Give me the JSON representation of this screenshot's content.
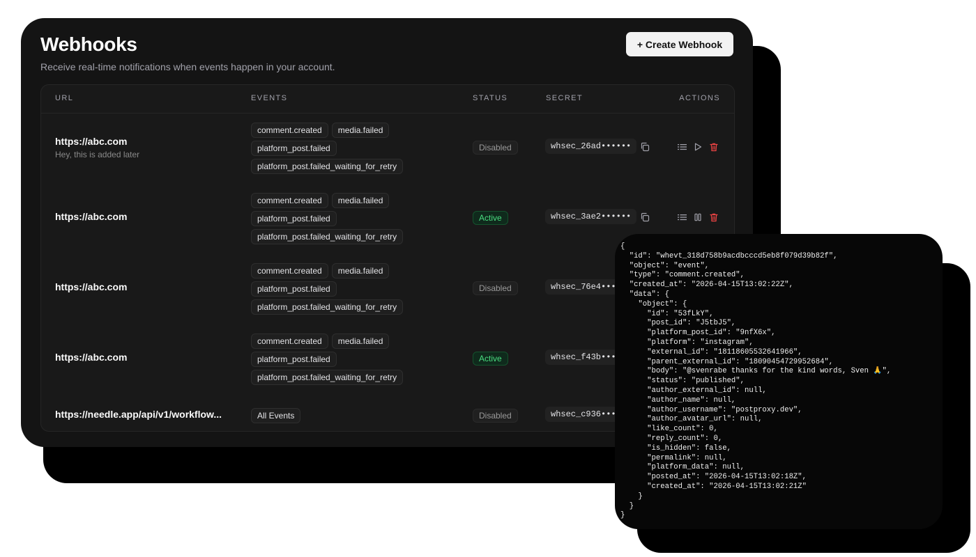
{
  "header": {
    "title": "Webhooks",
    "subtitle": "Receive real-time notifications when events happen in your account.",
    "create_button": "+ Create Webhook"
  },
  "table": {
    "columns": [
      "URL",
      "EVENTS",
      "STATUS",
      "SECRET",
      "ACTIONS"
    ],
    "rows": [
      {
        "url": "https://abc.com",
        "description": "Hey, this is added later",
        "events": [
          "comment.created",
          "media.failed",
          "platform_post.failed",
          "platform_post.failed_waiting_for_retry"
        ],
        "status": "Disabled",
        "secret": "whsec_26ad••••••"
      },
      {
        "url": "https://abc.com",
        "description": "",
        "events": [
          "comment.created",
          "media.failed",
          "platform_post.failed",
          "platform_post.failed_waiting_for_retry"
        ],
        "status": "Active",
        "secret": "whsec_3ae2••••••"
      },
      {
        "url": "https://abc.com",
        "description": "",
        "events": [
          "comment.created",
          "media.failed",
          "platform_post.failed",
          "platform_post.failed_waiting_for_retry"
        ],
        "status": "Disabled",
        "secret": "whsec_76e4••••••"
      },
      {
        "url": "https://abc.com",
        "description": "",
        "events": [
          "comment.created",
          "media.failed",
          "platform_post.failed",
          "platform_post.failed_waiting_for_retry"
        ],
        "status": "Active",
        "secret": "whsec_f43b••••••"
      },
      {
        "url": "https://needle.app/api/v1/workflow...",
        "description": "",
        "events": [
          "All Events"
        ],
        "status": "Disabled",
        "secret": "whsec_c936••••••"
      }
    ]
  },
  "colors": {
    "background": "#141414",
    "active": "#4ade80",
    "danger": "#ef4444"
  },
  "json_payload": "{\n  \"id\": \"whevt_318d758b9acdbcccd5eb8f079d39b82f\",\n  \"object\": \"event\",\n  \"type\": \"comment.created\",\n  \"created_at\": \"2026-04-15T13:02:22Z\",\n  \"data\": {\n    \"object\": {\n      \"id\": \"53fLkY\",\n      \"post_id\": \"J5tbJ5\",\n      \"platform_post_id\": \"9nfX6x\",\n      \"platform\": \"instagram\",\n      \"external_id\": \"18118605532641966\",\n      \"parent_external_id\": \"18090454729952684\",\n      \"body\": \"@svenrabe thanks for the kind words, Sven 🙏\",\n      \"status\": \"published\",\n      \"author_external_id\": null,\n      \"author_name\": null,\n      \"author_username\": \"postproxy.dev\",\n      \"author_avatar_url\": null,\n      \"like_count\": 0,\n      \"reply_count\": 0,\n      \"is_hidden\": false,\n      \"permalink\": null,\n      \"platform_data\": null,\n      \"posted_at\": \"2026-04-15T13:02:18Z\",\n      \"created_at\": \"2026-04-15T13:02:21Z\"\n    }\n  }\n}"
}
